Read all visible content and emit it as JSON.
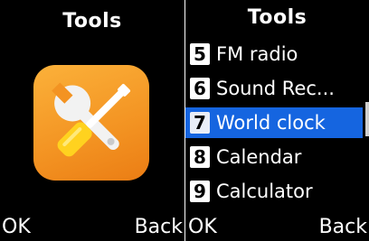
{
  "left_screen": {
    "title": "Tools",
    "app_icon": "tools-icon",
    "softkeys": {
      "left": "OK",
      "right": "Back"
    }
  },
  "right_screen": {
    "title": "Tools",
    "menu": [
      {
        "number": "5",
        "label": "FM radio",
        "selected": false
      },
      {
        "number": "6",
        "label": "Sound Rec...",
        "selected": false
      },
      {
        "number": "7",
        "label": "World clock",
        "selected": true
      },
      {
        "number": "8",
        "label": "Calendar",
        "selected": false
      },
      {
        "number": "9",
        "label": "Calculator",
        "selected": false
      }
    ],
    "softkeys": {
      "left": "OK",
      "right": "Back"
    }
  },
  "colors": {
    "background": "#000000",
    "text": "#ffffff",
    "selection": "#1565e0",
    "icon_orange": "#f39322"
  }
}
